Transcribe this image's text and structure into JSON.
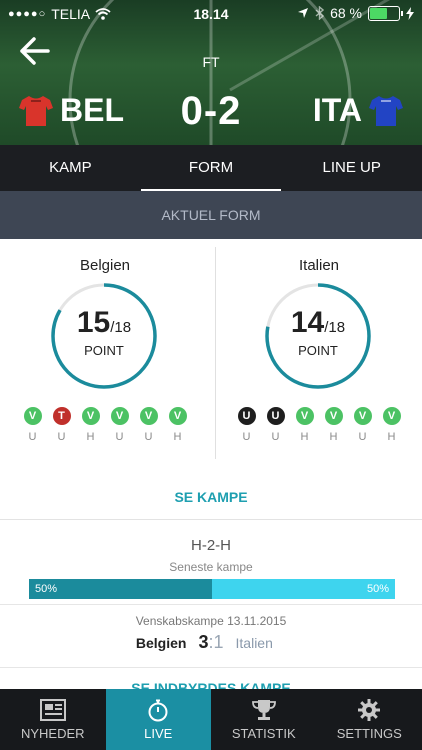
{
  "status_bar": {
    "carrier": "TELIA",
    "time": "18.14",
    "battery_percent": "68 %",
    "battery_level": 0.68
  },
  "match": {
    "status": "FT",
    "home_code": "BEL",
    "away_code": "ITA",
    "score": "0-2",
    "home_color": "#d9342b",
    "away_color": "#2244c4"
  },
  "tabs": [
    "KAMP",
    "FORM",
    "LINE UP"
  ],
  "section_title": "AKTUEL FORM",
  "form": {
    "home": {
      "country": "Belgien",
      "points": "15",
      "max": "/18",
      "points_label": "POINT",
      "fraction": 0.8333,
      "results": [
        {
          "r": "V",
          "venue": "U",
          "color": "#4cc264"
        },
        {
          "r": "T",
          "venue": "U",
          "color": "#c0302b"
        },
        {
          "r": "V",
          "venue": "H",
          "color": "#4cc264"
        },
        {
          "r": "V",
          "venue": "U",
          "color": "#4cc264"
        },
        {
          "r": "V",
          "venue": "U",
          "color": "#4cc264"
        },
        {
          "r": "V",
          "venue": "H",
          "color": "#4cc264"
        }
      ]
    },
    "away": {
      "country": "Italien",
      "points": "14",
      "max": "/18",
      "points_label": "POINT",
      "fraction": 0.7778,
      "results": [
        {
          "r": "U",
          "venue": "U",
          "color": "#1e1e1e"
        },
        {
          "r": "U",
          "venue": "U",
          "color": "#1e1e1e"
        },
        {
          "r": "V",
          "venue": "H",
          "color": "#4cc264"
        },
        {
          "r": "V",
          "venue": "H",
          "color": "#4cc264"
        },
        {
          "r": "V",
          "venue": "U",
          "color": "#4cc264"
        },
        {
          "r": "V",
          "venue": "H",
          "color": "#4cc264"
        }
      ]
    }
  },
  "see_matches": "SE KAMPE",
  "h2h": {
    "title": "H-2-H",
    "subtitle": "Seneste kampe",
    "home_pct": "50%",
    "away_pct": "50%",
    "home_share": 0.5,
    "last_match": {
      "meta": "Venskabskampe 13.11.2015",
      "home": "Belgien",
      "home_goals": "3",
      "sep": ":",
      "away_goals": "1",
      "away": "Italien"
    },
    "cut_link": "SE INDBYRDES KAMPE"
  },
  "nav": [
    {
      "label": "NYHEDER",
      "icon": "newspaper-icon"
    },
    {
      "label": "LIVE",
      "icon": "stopwatch-icon"
    },
    {
      "label": "STATISTIK",
      "icon": "trophy-icon"
    },
    {
      "label": "SETTINGS",
      "icon": "gear-icon"
    }
  ]
}
